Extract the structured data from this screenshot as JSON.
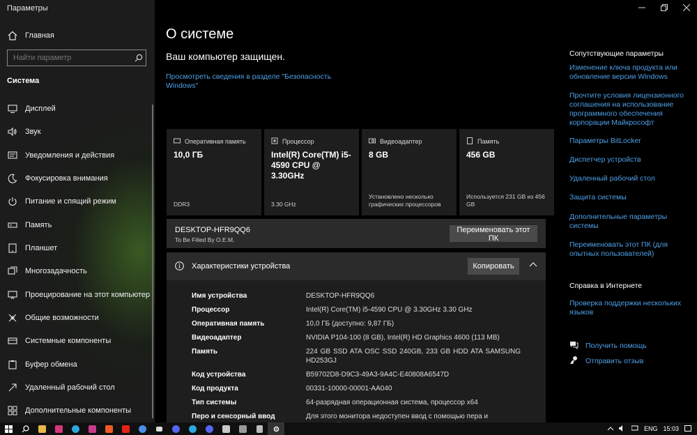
{
  "window": {
    "title": "Параметры"
  },
  "sidebar": {
    "home_label": "Главная",
    "search_placeholder": "Найти параметр",
    "section": "Система",
    "items": [
      {
        "label": "Дисплей",
        "icon": "monitor-icon"
      },
      {
        "label": "Звук",
        "icon": "speaker-icon"
      },
      {
        "label": "Уведомления и действия",
        "icon": "notification-icon"
      },
      {
        "label": "Фокусировка внимания",
        "icon": "moon-icon"
      },
      {
        "label": "Питание и спящий режим",
        "icon": "power-icon"
      },
      {
        "label": "Память",
        "icon": "storage-icon"
      },
      {
        "label": "Планшет",
        "icon": "tablet-icon"
      },
      {
        "label": "Многозадачность",
        "icon": "multitask-icon"
      },
      {
        "label": "Проецирование на этот компьютер",
        "icon": "project-icon"
      },
      {
        "label": "Общие возможности",
        "icon": "shared-icon"
      },
      {
        "label": "Системные компоненты",
        "icon": "components-icon"
      },
      {
        "label": "Буфер обмена",
        "icon": "clipboard-icon"
      },
      {
        "label": "Удаленный рабочий стол",
        "icon": "remote-icon"
      },
      {
        "label": "Дополнительные компоненты",
        "icon": "extra-icon"
      }
    ]
  },
  "main": {
    "title": "О системе",
    "protected": "Ваш компьютер защищен.",
    "security_link": "Просмотреть сведения в разделе \"Безопасность Windows\"",
    "cards": [
      {
        "head": "Оперативная память",
        "value": "10,0 ГБ",
        "sub": "DDR3",
        "icon": "ram-icon"
      },
      {
        "head": "Процессор",
        "value": "Intel(R) Core(TM) i5-4590 CPU @ 3.30GHz",
        "sub": "3.30 GHz",
        "icon": "cpu-icon"
      },
      {
        "head": "Видеоадаптер",
        "value": "8 GB",
        "sub": "Установлено несколько графических процессоров",
        "icon": "gpu-icon"
      },
      {
        "head": "Память",
        "value": "456 GB",
        "sub": "Используется 231 GB из 456 GB",
        "icon": "disk-icon"
      }
    ],
    "pc_name": "DESKTOP-HFR9QQ6",
    "pc_oem": "To Be Filled By O.E.M.",
    "rename_label": "Переименовать этот ПК",
    "spec_title": "Характеристики устройства",
    "copy_label": "Копировать",
    "specs": [
      {
        "k": "Имя устройства",
        "v": "DESKTOP-HFR9QQ6"
      },
      {
        "k": "Процессор",
        "v": "Intel(R) Core(TM) i5-4590 CPU @ 3.30GHz   3.30 GHz"
      },
      {
        "k": "Оперативная память",
        "v": "10,0 ГБ (доступно: 9,87 ГБ)"
      },
      {
        "k": "Видеоадаптер",
        "v": "NVIDIA P104-100 (8 GB), Intel(R) HD Graphics 4600 (113 MB)"
      },
      {
        "k": "Память",
        "v": "224 GB SSD ATA OSC SSD 240GB, 233 GB HDD ATA SAMSUNG HD253GJ"
      },
      {
        "k": "Код устройства",
        "v": "B59702D8-D9C3-49A3-9A4C-E40808A6547D"
      },
      {
        "k": "Код продукта",
        "v": "00331-10000-00001-AA040"
      },
      {
        "k": "Тип системы",
        "v": "64-разрядная операционная система, процессор x64"
      },
      {
        "k": "Перо и сенсорный ввод",
        "v": "Для этого монитора недоступен ввод с помощью пера и сенсорный"
      }
    ]
  },
  "related": {
    "heading": "Сопутствующие параметры",
    "links": [
      "Изменение ключа продукта или обновление версии Windows",
      "Прочтите условия лицензионного соглашения на использование программного обеспечения корпорации Майкрософт",
      "Параметры BitLocker",
      "Диспетчер устройств",
      "Удаленный рабочий стол",
      "Защита системы",
      "Дополнительные параметры системы",
      "Переименовать этот ПК (для опытных пользователей)"
    ]
  },
  "help": {
    "heading": "Справка в Интернете",
    "link": "Проверка поддержки нескольких языков",
    "get_help": "Получить помощь",
    "feedback": "Отправить отзыв"
  },
  "taskbar": {
    "lang": "ENG",
    "time": "15:03",
    "apps": [
      "start-icon",
      "search-icon",
      "explorer-icon",
      "instagram-icon",
      "telegram-icon",
      "instagram-icon",
      "brave-icon",
      "youtube-icon",
      "chrome-icon",
      "steam-icon",
      "discord-icon",
      "telegram-icon",
      "discord-icon",
      "app-icon",
      "app-icon",
      "pen-icon",
      "settings-icon"
    ],
    "colors": {
      "accent": "#4ea0e6"
    }
  }
}
